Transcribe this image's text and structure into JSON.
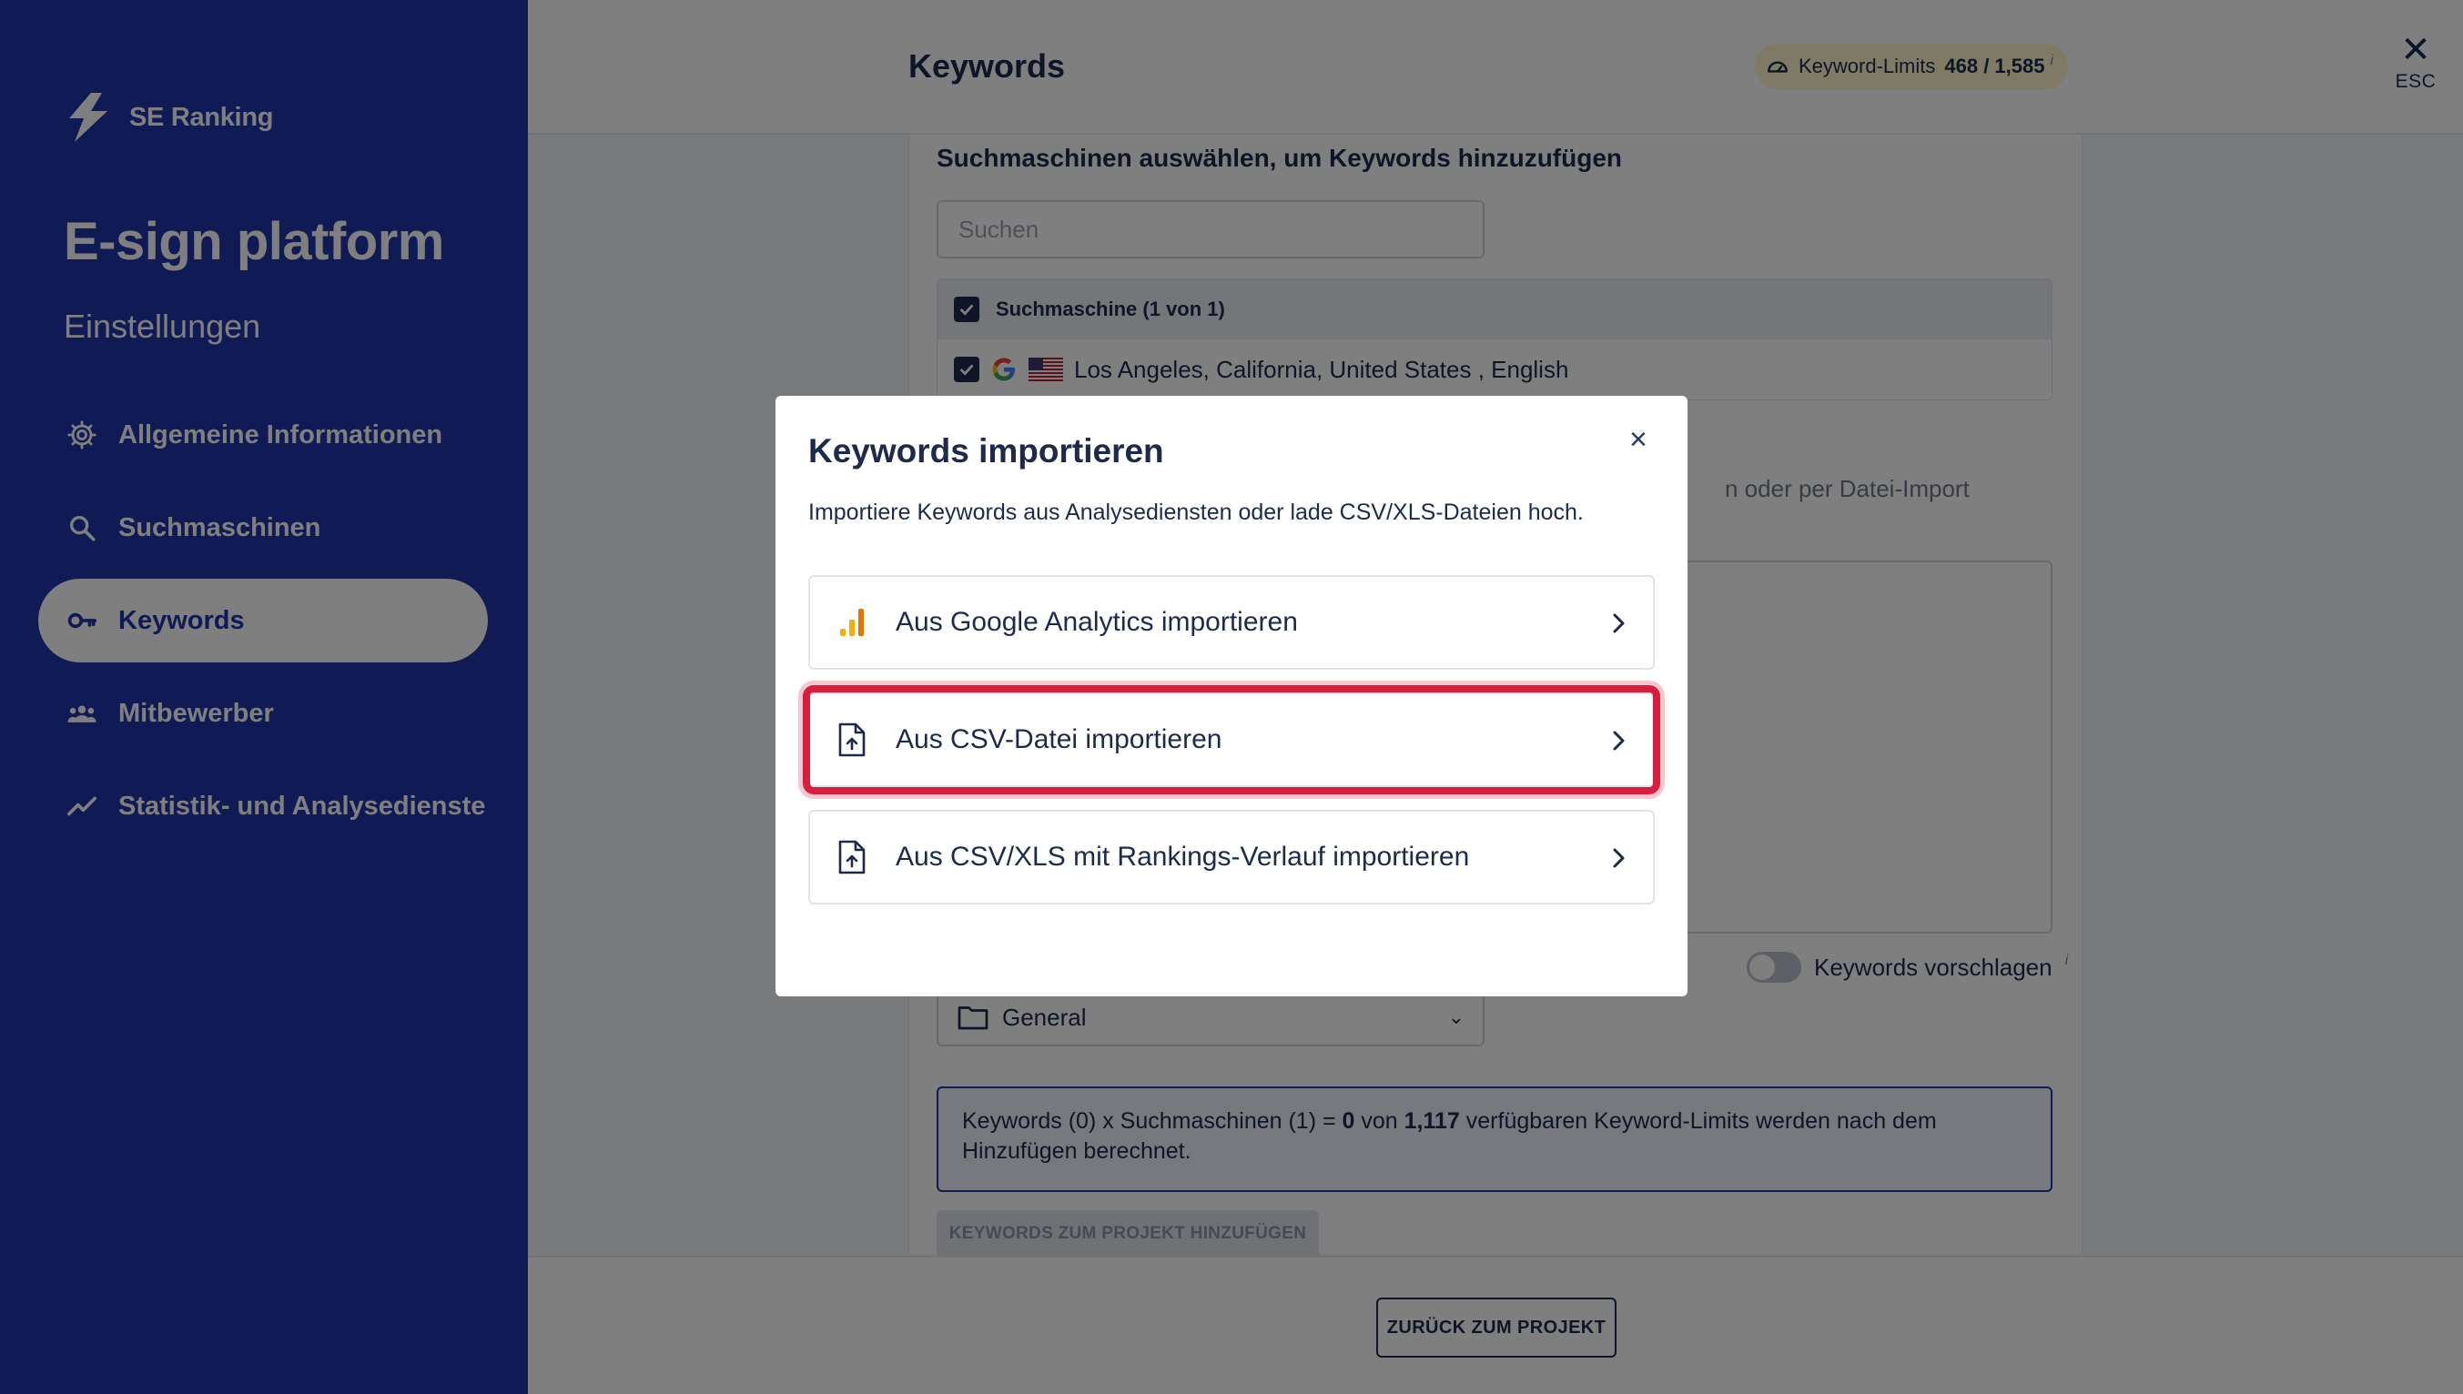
{
  "app": {
    "name": "SE Ranking"
  },
  "sidebar": {
    "project_title": "E-sign platform",
    "subtitle": "Einstellungen",
    "items": [
      {
        "label": "Allgemeine Informationen",
        "icon": "gear-icon"
      },
      {
        "label": "Suchmaschinen",
        "icon": "search-icon"
      },
      {
        "label": "Keywords",
        "icon": "key-icon",
        "active": true
      },
      {
        "label": "Mitbewerber",
        "icon": "users-icon"
      },
      {
        "label": "Statistik- und Analysedienste",
        "icon": "trend-icon"
      }
    ]
  },
  "header": {
    "title": "Keywords",
    "limits_label": "Keyword-Limits",
    "limits_value": "468 / 1,585",
    "info": "i",
    "close_label": "ESC"
  },
  "main": {
    "section_title": "Suchmaschinen auswählen, um Keywords hinzuzufügen",
    "search_placeholder": "Suchen",
    "engines_header": "Suchmaschine (1 von 1)",
    "engine_row": "Los Angeles, California, United States , English",
    "hint": "n oder per Datei-Import",
    "suggest_label": "Keywords vorschlagen",
    "group_value": "General",
    "info_text_pre": "Keywords (0) x Suchmaschinen (1) = ",
    "info_zero": "0",
    "info_mid": " von ",
    "info_limit": "1,117",
    "info_text_post": " verfügbaren Keyword-Limits werden nach dem Hinzufügen berechnet.",
    "add_button": "KEYWORDS ZUM PROJEKT HINZUFÜGEN",
    "back_button": "ZURÜCK ZUM PROJEKT"
  },
  "modal": {
    "title": "Keywords importieren",
    "description": "Importiere Keywords aus Analysediensten oder lade CSV/XLS-Dateien hoch.",
    "options": [
      {
        "label": "Aus Google Analytics importieren",
        "icon": "analytics-icon"
      },
      {
        "label": "Aus CSV-Datei importieren",
        "icon": "file-upload-icon",
        "highlighted": true
      },
      {
        "label": "Aus CSV/XLS mit Rankings-Verlauf importieren",
        "icon": "file-upload-icon"
      }
    ]
  },
  "colors": {
    "sidebar": "#2135ab",
    "highlight": "#d81e3f",
    "overlay": "rgba(0,0,0,0.5)"
  }
}
